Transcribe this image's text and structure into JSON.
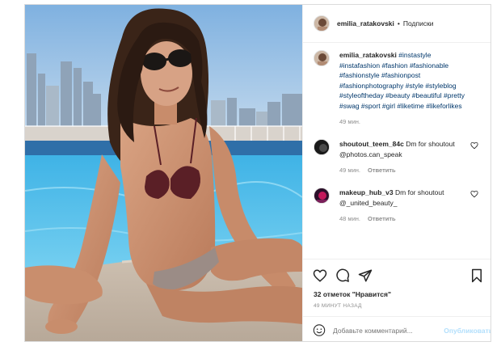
{
  "post": {
    "author": "emilia_ratakovski",
    "separator": "•",
    "follow_label": "Подписки"
  },
  "caption": {
    "username": "emilia_ratakovski",
    "text": "#instastyle #instafashion #fashion #fashionable #fashionstyle #fashionpost #fashionphotography #style #styleblog #styleoftheday #beauty #beautiful #pretty #swag #sport #girl #liketime #likeforlikes",
    "time": "49 мин."
  },
  "comments": [
    {
      "username": "shoutout_teem_84c",
      "text": "Dm for shoutout @photos.can_speak",
      "time": "49 мин.",
      "reply_label": "Ответить"
    },
    {
      "username": "makeup_hub_v3",
      "text": "Dm for shoutout @_united_beauty_",
      "time": "48 мин.",
      "reply_label": "Ответить"
    }
  ],
  "actions": {
    "likes": "32 отметок \"Нравится\"",
    "timestamp": "49 МИНУТ НАЗАД",
    "add_comment_placeholder": "Добавьте комментарий...",
    "publish_label": "Опубликовать"
  },
  "icons": [
    "heart-icon",
    "comment-icon",
    "share-icon",
    "bookmark-icon",
    "emoji-icon",
    "small-heart-icon"
  ],
  "colors": {
    "hashtag": "#00376b",
    "muted": "#8e8e8e",
    "publish_disabled": "#b2dffc",
    "border": "#dbdbdb"
  }
}
